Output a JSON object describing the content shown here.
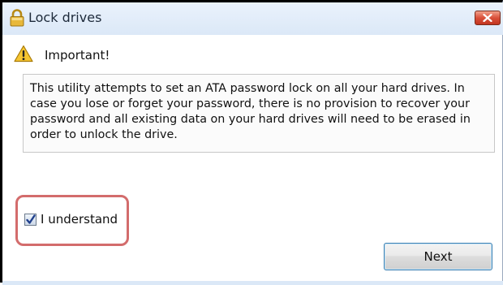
{
  "window": {
    "title": "Lock drives",
    "title_icon": "lock-icon",
    "close_icon": "close-icon"
  },
  "warning": {
    "icon": "warning-icon",
    "label": "Important!"
  },
  "message": "This utility attempts to set an ATA password lock on all your hard drives. In case you lose or forget your password, there is no provision to recover your password and all existing data on your hard drives will need to be erased in order to unlock the drive.",
  "acknowledge": {
    "label": "I understand",
    "checked": true
  },
  "actions": {
    "next_label": "Next"
  },
  "colors": {
    "titlebar": "#dbe8f7",
    "close_button": "#d9503a",
    "highlight_ring": "#d36c6c",
    "button_border": "#3c7fb1"
  }
}
